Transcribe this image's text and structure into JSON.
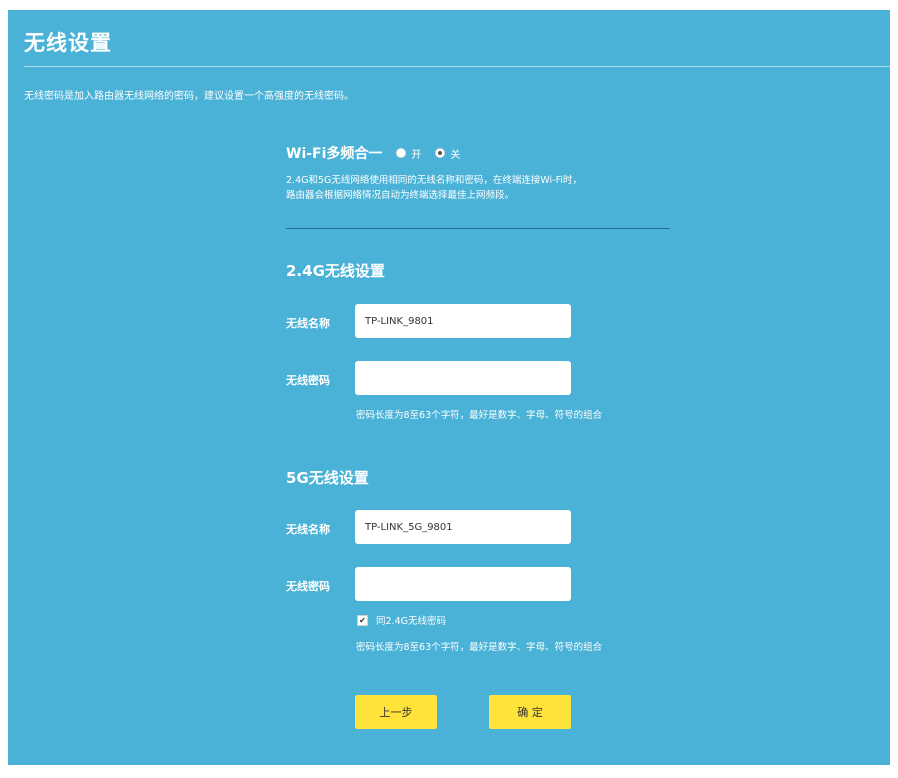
{
  "page": {
    "title": "无线设置",
    "intro": "无线密码是加入路由器无线网络的密码，建议设置一个高强度的无线密码。"
  },
  "wifi_combine": {
    "label": "Wi-Fi多频合一",
    "option_on": "开",
    "option_off": "关",
    "selected": "关",
    "desc_line1": "2.4G和5G无线网络使用相同的无线名称和密码，在终端连接Wi-Fi时，",
    "desc_line2": "路由器会根据网络情况自动为终端选择最佳上网频段。"
  },
  "band_24g": {
    "title": "2.4G无线设置",
    "name_label": "无线名称",
    "name_value": "TP-LINK_9801",
    "password_label": "无线密码",
    "password_value": "",
    "hint": "密码长度为8至63个字符，最好是数字、字母、符号的组合"
  },
  "band_5g": {
    "title": "5G无线设置",
    "name_label": "无线名称",
    "name_value": "TP-LINK_5G_9801",
    "password_label": "无线密码",
    "password_value": "",
    "same_password_label": "同2.4G无线密码",
    "same_password_checked": true,
    "hint": "密码长度为8至63个字符，最好是数字、字母、符号的组合"
  },
  "buttons": {
    "prev": "上一步",
    "confirm": "确 定"
  },
  "colors": {
    "background": "#4ab2d7",
    "button": "#ffe33a"
  }
}
